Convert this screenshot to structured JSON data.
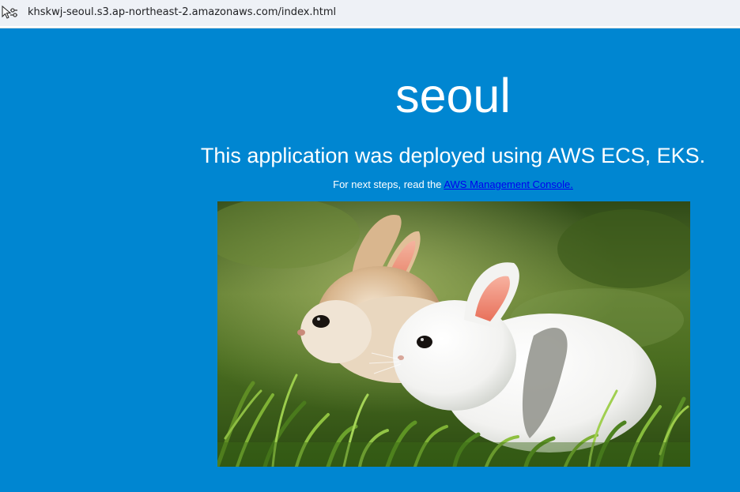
{
  "browser": {
    "url": "khskwj-seoul.s3.ap-northeast-2.amazonaws.com/index.html",
    "site_info_icon": "tune-icon"
  },
  "page": {
    "title": "seoul",
    "subtitle": "This application was deployed using AWS ECS, EKS.",
    "next_steps_prefix": "For next steps, read the ",
    "next_steps_link": "AWS Management Console.",
    "image_icon": "rabbits-photo",
    "background_color": "#0086d1",
    "text_color": "#ffffff",
    "link_color": "#0000ee"
  }
}
